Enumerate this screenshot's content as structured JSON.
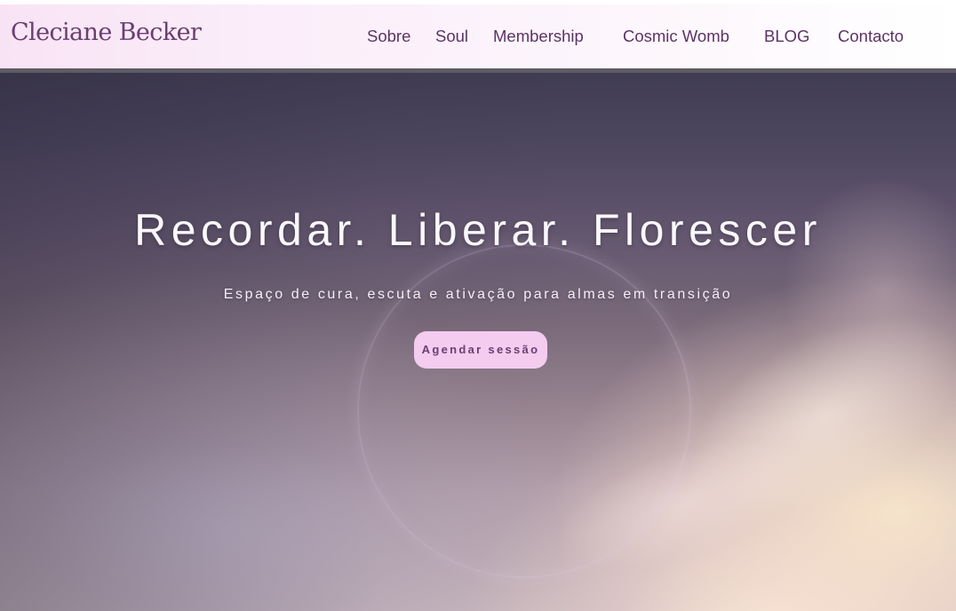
{
  "header": {
    "logo": "Cleciane Becker",
    "nav": [
      {
        "label": "Sobre"
      },
      {
        "label": "Soul"
      },
      {
        "label": "Membership"
      },
      {
        "label": "Cosmic Womb"
      },
      {
        "label": "BLOG"
      },
      {
        "label": "Contacto"
      }
    ]
  },
  "hero": {
    "title": "Recordar. Liberar. Florescer",
    "subtitle": "Espaço de cura, escuta e ativação para almas em transição",
    "cta_label": "Agendar sessão",
    "background_image": "sunset-sky-with-moon-halo"
  },
  "colors": {
    "brand_text": "#6a3f72",
    "nav_text": "#5c3366",
    "cta_background": "#f3ccf0",
    "header_gradient_start": "#f8e3f4"
  }
}
